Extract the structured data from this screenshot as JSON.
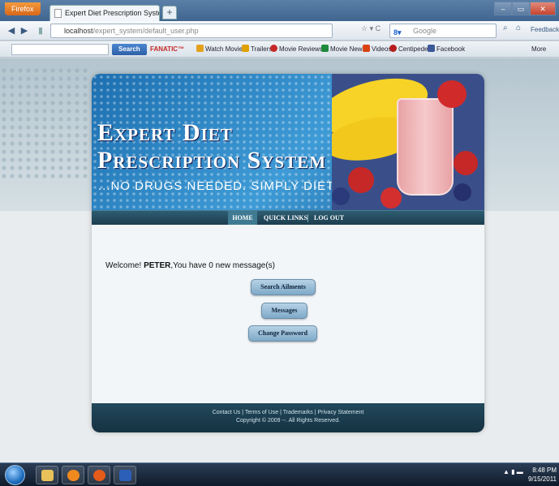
{
  "browser": {
    "app_button": "Firefox",
    "tab_title": "Expert Diet Prescription System",
    "new_tab": "+",
    "url_host": "localhost",
    "url_path": "/expert_system/default_user.php",
    "search_engine": "Google",
    "feedback": "Feedback",
    "window_controls": [
      "–",
      "▭",
      "✕"
    ]
  },
  "toolbar": {
    "search_button": "Search",
    "items": [
      "FANATIC™",
      "Watch Movies",
      "Trailers",
      "Movie Reviews",
      "Movie News",
      "Videos",
      "Centipede",
      "Facebook"
    ],
    "more": "More"
  },
  "site": {
    "title_line1": "Expert Diet",
    "title_line2": "Prescription System",
    "tagline": "...NO DRUGS NEEDED. SIMPLY DIET",
    "menu": {
      "home": "HOME",
      "quick_links": "QUICK LINKS",
      "log_out": "LOG OUT"
    },
    "welcome_prefix": "Welcome! ",
    "username": "PETER",
    "welcome_suffix": ",You have  0 new message(s)",
    "buttons": {
      "search_ailments": "Search Ailments",
      "messages": "Messages",
      "change_password": "Change Password"
    },
    "footer_links": "Contact Us | Terms of Use | Trademarks | Privacy Statement",
    "footer_copy": "Copyright © 2009 --. All Rights Reserved."
  },
  "taskbar": {
    "time": "8:48 PM",
    "date": "9/15/2011"
  },
  "colors": {
    "banner_blue": "#2b86c6",
    "menu_teal": "#1d3e4f",
    "button_blue": "#9ec1dc"
  }
}
